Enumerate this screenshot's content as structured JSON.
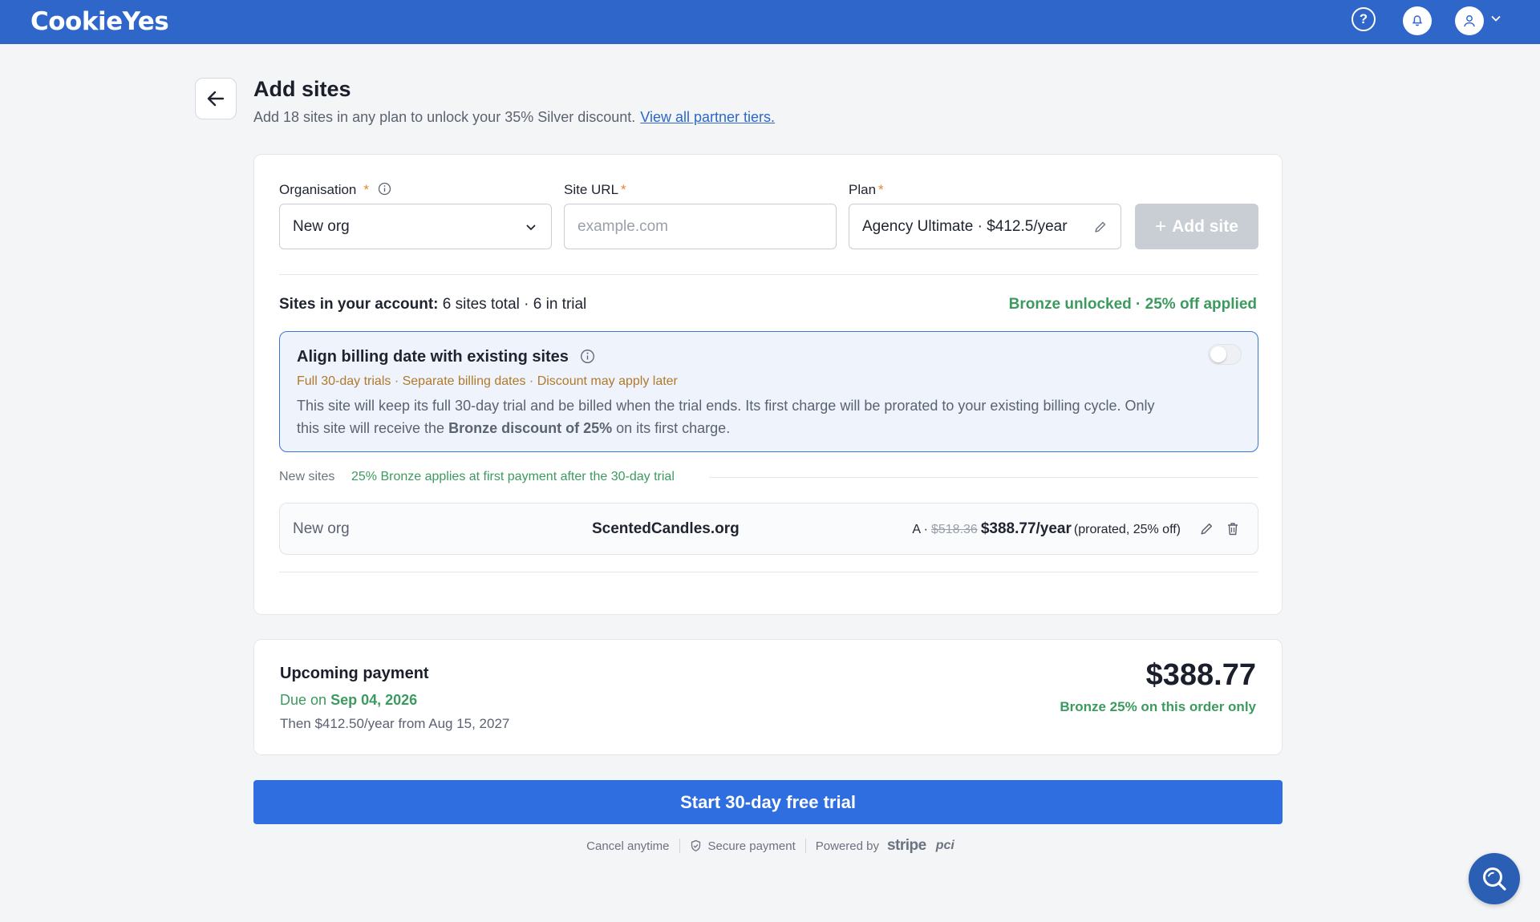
{
  "app": {
    "logo": "CookieYes"
  },
  "topbar": {
    "icons": [
      "help-icon",
      "bell-icon",
      "user-icon",
      "chevron-down-icon"
    ]
  },
  "header": {
    "title": "Add sites",
    "subtitle": "Add 18 sites in any plan to unlock your 35% Silver discount.",
    "link": "View all partner tiers."
  },
  "form": {
    "organisation_label": "Organisation",
    "organisation_value": "New org",
    "site_url_label": "Site URL",
    "site_url_placeholder": "example.com",
    "plan_label": "Plan",
    "plan_value": "Agency Ultimate · $412.5/year",
    "required_mark": "*",
    "add_button": "Add site"
  },
  "account": {
    "label": "Sites in your account:",
    "summary": "6 sites total · 6 in trial",
    "discount_status": "Bronze unlocked · 25% off applied"
  },
  "align": {
    "title": "Align billing date with existing sites",
    "tags": "Full 30-day trials · Separate billing dates · Discount may apply later",
    "desc_pre": "This site will keep its full 30-day trial and be billed when the trial ends. Its first charge will be prorated to your existing billing cycle. Only this site will receive the",
    "desc_bold": "Bronze discount of 25%",
    "desc_post": "on its first charge.",
    "toggle_on": false
  },
  "new_sites": {
    "label": "New sites",
    "note": "25% Bronze applies at first payment after the 30-day trial",
    "rows": [
      {
        "org": "New org",
        "domain": "ScentedCandles.org",
        "plan_code": "A ·",
        "old_price": "$518.36",
        "new_price": "$388.77/year",
        "note": "(prorated, 25% off)"
      }
    ]
  },
  "payment": {
    "title": "Upcoming payment",
    "due_prefix": "Due on",
    "due_date": "Sep 04, 2026",
    "then": "Then $412.50/year from Aug 15, 2027",
    "amount": "$388.77",
    "discount_note": "Bronze 25% on this order only"
  },
  "cta": {
    "label": "Start 30-day free trial"
  },
  "footer": {
    "cancel": "Cancel anytime",
    "secure": "Secure payment",
    "powered": "Powered by",
    "stripe": "stripe",
    "pci": "pci"
  },
  "colors": {
    "brand": "#2e67c9",
    "cta": "#2f6ee0",
    "success": "#3c9a5f",
    "warning": "#b07a2a"
  }
}
